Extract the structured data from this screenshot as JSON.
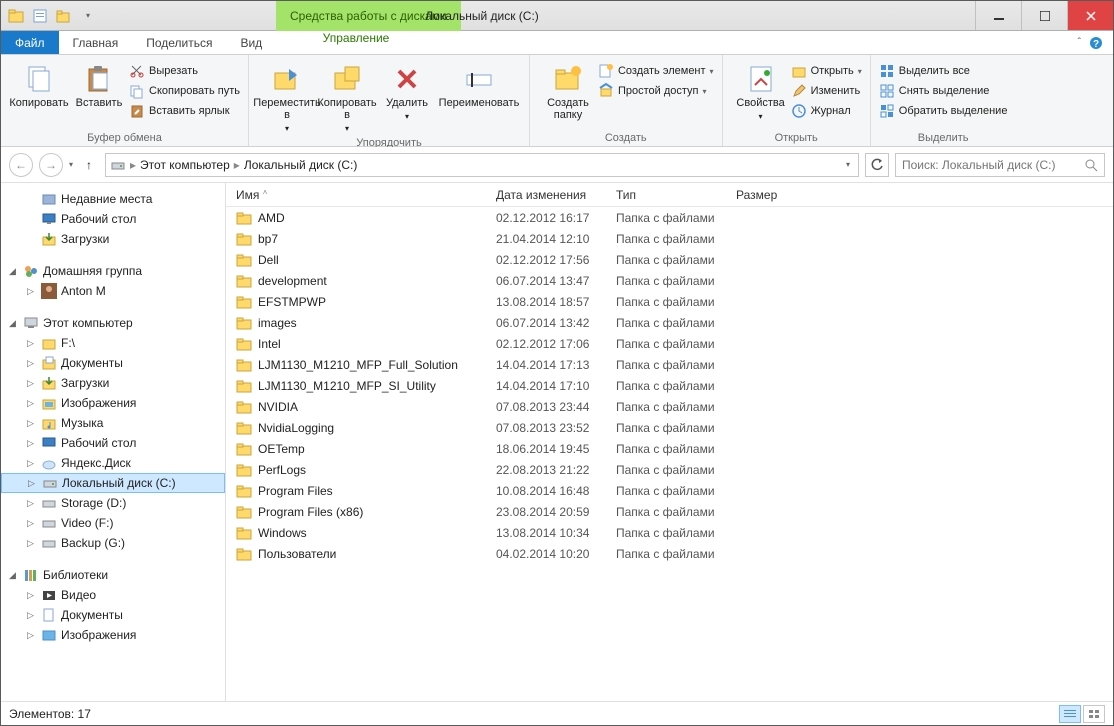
{
  "window": {
    "title": "Локальный диск (C:)",
    "contextual_tab": "Средства работы с дисками"
  },
  "tabs": {
    "file": "Файл",
    "home": "Главная",
    "share": "Поделиться",
    "view": "Вид",
    "manage": "Управление"
  },
  "ribbon": {
    "clipboard": {
      "copy": "Копировать",
      "paste": "Вставить",
      "cut": "Вырезать",
      "copy_path": "Скопировать путь",
      "paste_shortcut": "Вставить ярлык",
      "label": "Буфер обмена"
    },
    "organize": {
      "move_to": "Переместить в",
      "copy_to": "Копировать в",
      "delete": "Удалить",
      "rename": "Переименовать",
      "label": "Упорядочить"
    },
    "new": {
      "new_folder": "Создать папку",
      "new_item": "Создать элемент",
      "easy_access": "Простой доступ",
      "label": "Создать"
    },
    "open": {
      "properties": "Свойства",
      "open": "Открыть",
      "edit": "Изменить",
      "history": "Журнал",
      "label": "Открыть"
    },
    "select": {
      "select_all": "Выделить все",
      "select_none": "Снять выделение",
      "invert": "Обратить выделение",
      "label": "Выделить"
    }
  },
  "breadcrumb": {
    "root": "Этот компьютер",
    "current": "Локальный диск (C:)"
  },
  "search": {
    "placeholder": "Поиск: Локальный диск (C:)"
  },
  "sidebar": {
    "recent": "Недавние места",
    "desktop": "Рабочий стол",
    "downloads": "Загрузки",
    "homegroup": "Домашняя группа",
    "user": "Anton M",
    "this_pc": "Этот компьютер",
    "drive_f": "F:\\",
    "documents": "Документы",
    "dl2": "Загрузки",
    "pictures": "Изображения",
    "music": "Музыка",
    "desk2": "Рабочий стол",
    "yandex": "Яндекс.Диск",
    "drive_c": "Локальный диск (C:)",
    "drive_d": "Storage (D:)",
    "drive_vf": "Video (F:)",
    "drive_g": "Backup (G:)",
    "libraries": "Библиотеки",
    "lib_video": "Видео",
    "lib_docs": "Документы",
    "lib_pics": "Изображения"
  },
  "columns": {
    "name": "Имя",
    "date": "Дата изменения",
    "type": "Тип",
    "size": "Размер"
  },
  "files": [
    {
      "name": "AMD",
      "date": "02.12.2012 16:17",
      "type": "Папка с файлами"
    },
    {
      "name": "bp7",
      "date": "21.04.2014 12:10",
      "type": "Папка с файлами"
    },
    {
      "name": "Dell",
      "date": "02.12.2012 17:56",
      "type": "Папка с файлами"
    },
    {
      "name": "development",
      "date": "06.07.2014 13:47",
      "type": "Папка с файлами"
    },
    {
      "name": "EFSTMPWP",
      "date": "13.08.2014 18:57",
      "type": "Папка с файлами"
    },
    {
      "name": "images",
      "date": "06.07.2014 13:42",
      "type": "Папка с файлами"
    },
    {
      "name": "Intel",
      "date": "02.12.2012 17:06",
      "type": "Папка с файлами"
    },
    {
      "name": "LJM1130_M1210_MFP_Full_Solution",
      "date": "14.04.2014 17:13",
      "type": "Папка с файлами"
    },
    {
      "name": "LJM1130_M1210_MFP_SI_Utility",
      "date": "14.04.2014 17:10",
      "type": "Папка с файлами"
    },
    {
      "name": "NVIDIA",
      "date": "07.08.2013 23:44",
      "type": "Папка с файлами"
    },
    {
      "name": "NvidiaLogging",
      "date": "07.08.2013 23:52",
      "type": "Папка с файлами"
    },
    {
      "name": "OETemp",
      "date": "18.06.2014 19:45",
      "type": "Папка с файлами"
    },
    {
      "name": "PerfLogs",
      "date": "22.08.2013 21:22",
      "type": "Папка с файлами"
    },
    {
      "name": "Program Files",
      "date": "10.08.2014 16:48",
      "type": "Папка с файлами"
    },
    {
      "name": "Program Files (x86)",
      "date": "23.08.2014 20:59",
      "type": "Папка с файлами"
    },
    {
      "name": "Windows",
      "date": "13.08.2014 10:34",
      "type": "Папка с файлами"
    },
    {
      "name": "Пользователи",
      "date": "04.02.2014 10:20",
      "type": "Папка с файлами"
    }
  ],
  "status": {
    "count_label": "Элементов: 17"
  }
}
